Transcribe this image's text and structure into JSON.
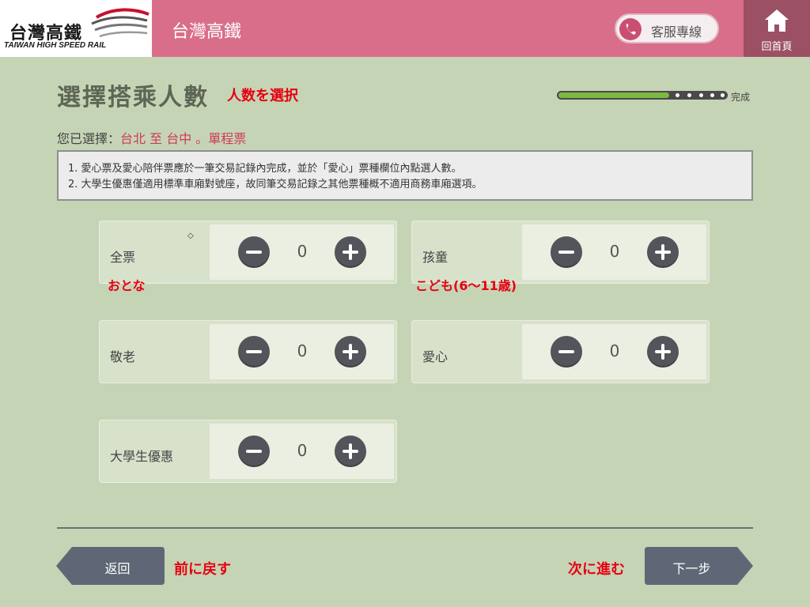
{
  "header": {
    "logo_zh": "台灣高鐵",
    "logo_en": "TAIWAN HIGH SPEED RAIL",
    "title": "台灣高鐵",
    "hotline_label": "客服專線",
    "home_label": "回首頁"
  },
  "page": {
    "title": "選擇搭乘人數",
    "title_jp": "人数を選択",
    "progress_label": "完成",
    "progress_fraction": 0.66
  },
  "selection": {
    "prefix": "您已選擇：",
    "value": "台北 至 台中 。單程票"
  },
  "notice": {
    "lines": [
      "1. 愛心票及愛心陪伴票應於一筆交易記錄內完成，並於「愛心」票種欄位內點選人數。",
      "2. 大學生優惠僅適用標準車廂對號座，故同筆交易記錄之其他票種概不適用商務車廂選項。"
    ]
  },
  "tickets": [
    {
      "label": "全票",
      "count": "0",
      "note_jp": "おとな"
    },
    {
      "label": "孩童",
      "count": "0",
      "note_jp": "こども(6～11歳)"
    },
    {
      "label": "敬老",
      "count": "0"
    },
    {
      "label": "愛心",
      "count": "0"
    },
    {
      "label": "大學生優惠",
      "count": "0"
    }
  ],
  "nav": {
    "back_label": "返回",
    "back_jp": "前に戻す",
    "next_label": "下一步",
    "next_jp": "次に進む"
  },
  "colors": {
    "header": "#d96e8a",
    "home": "#9c5064",
    "background": "#c6d4b6",
    "accent_red": "#e60012",
    "progress_green": "#7cb842"
  }
}
